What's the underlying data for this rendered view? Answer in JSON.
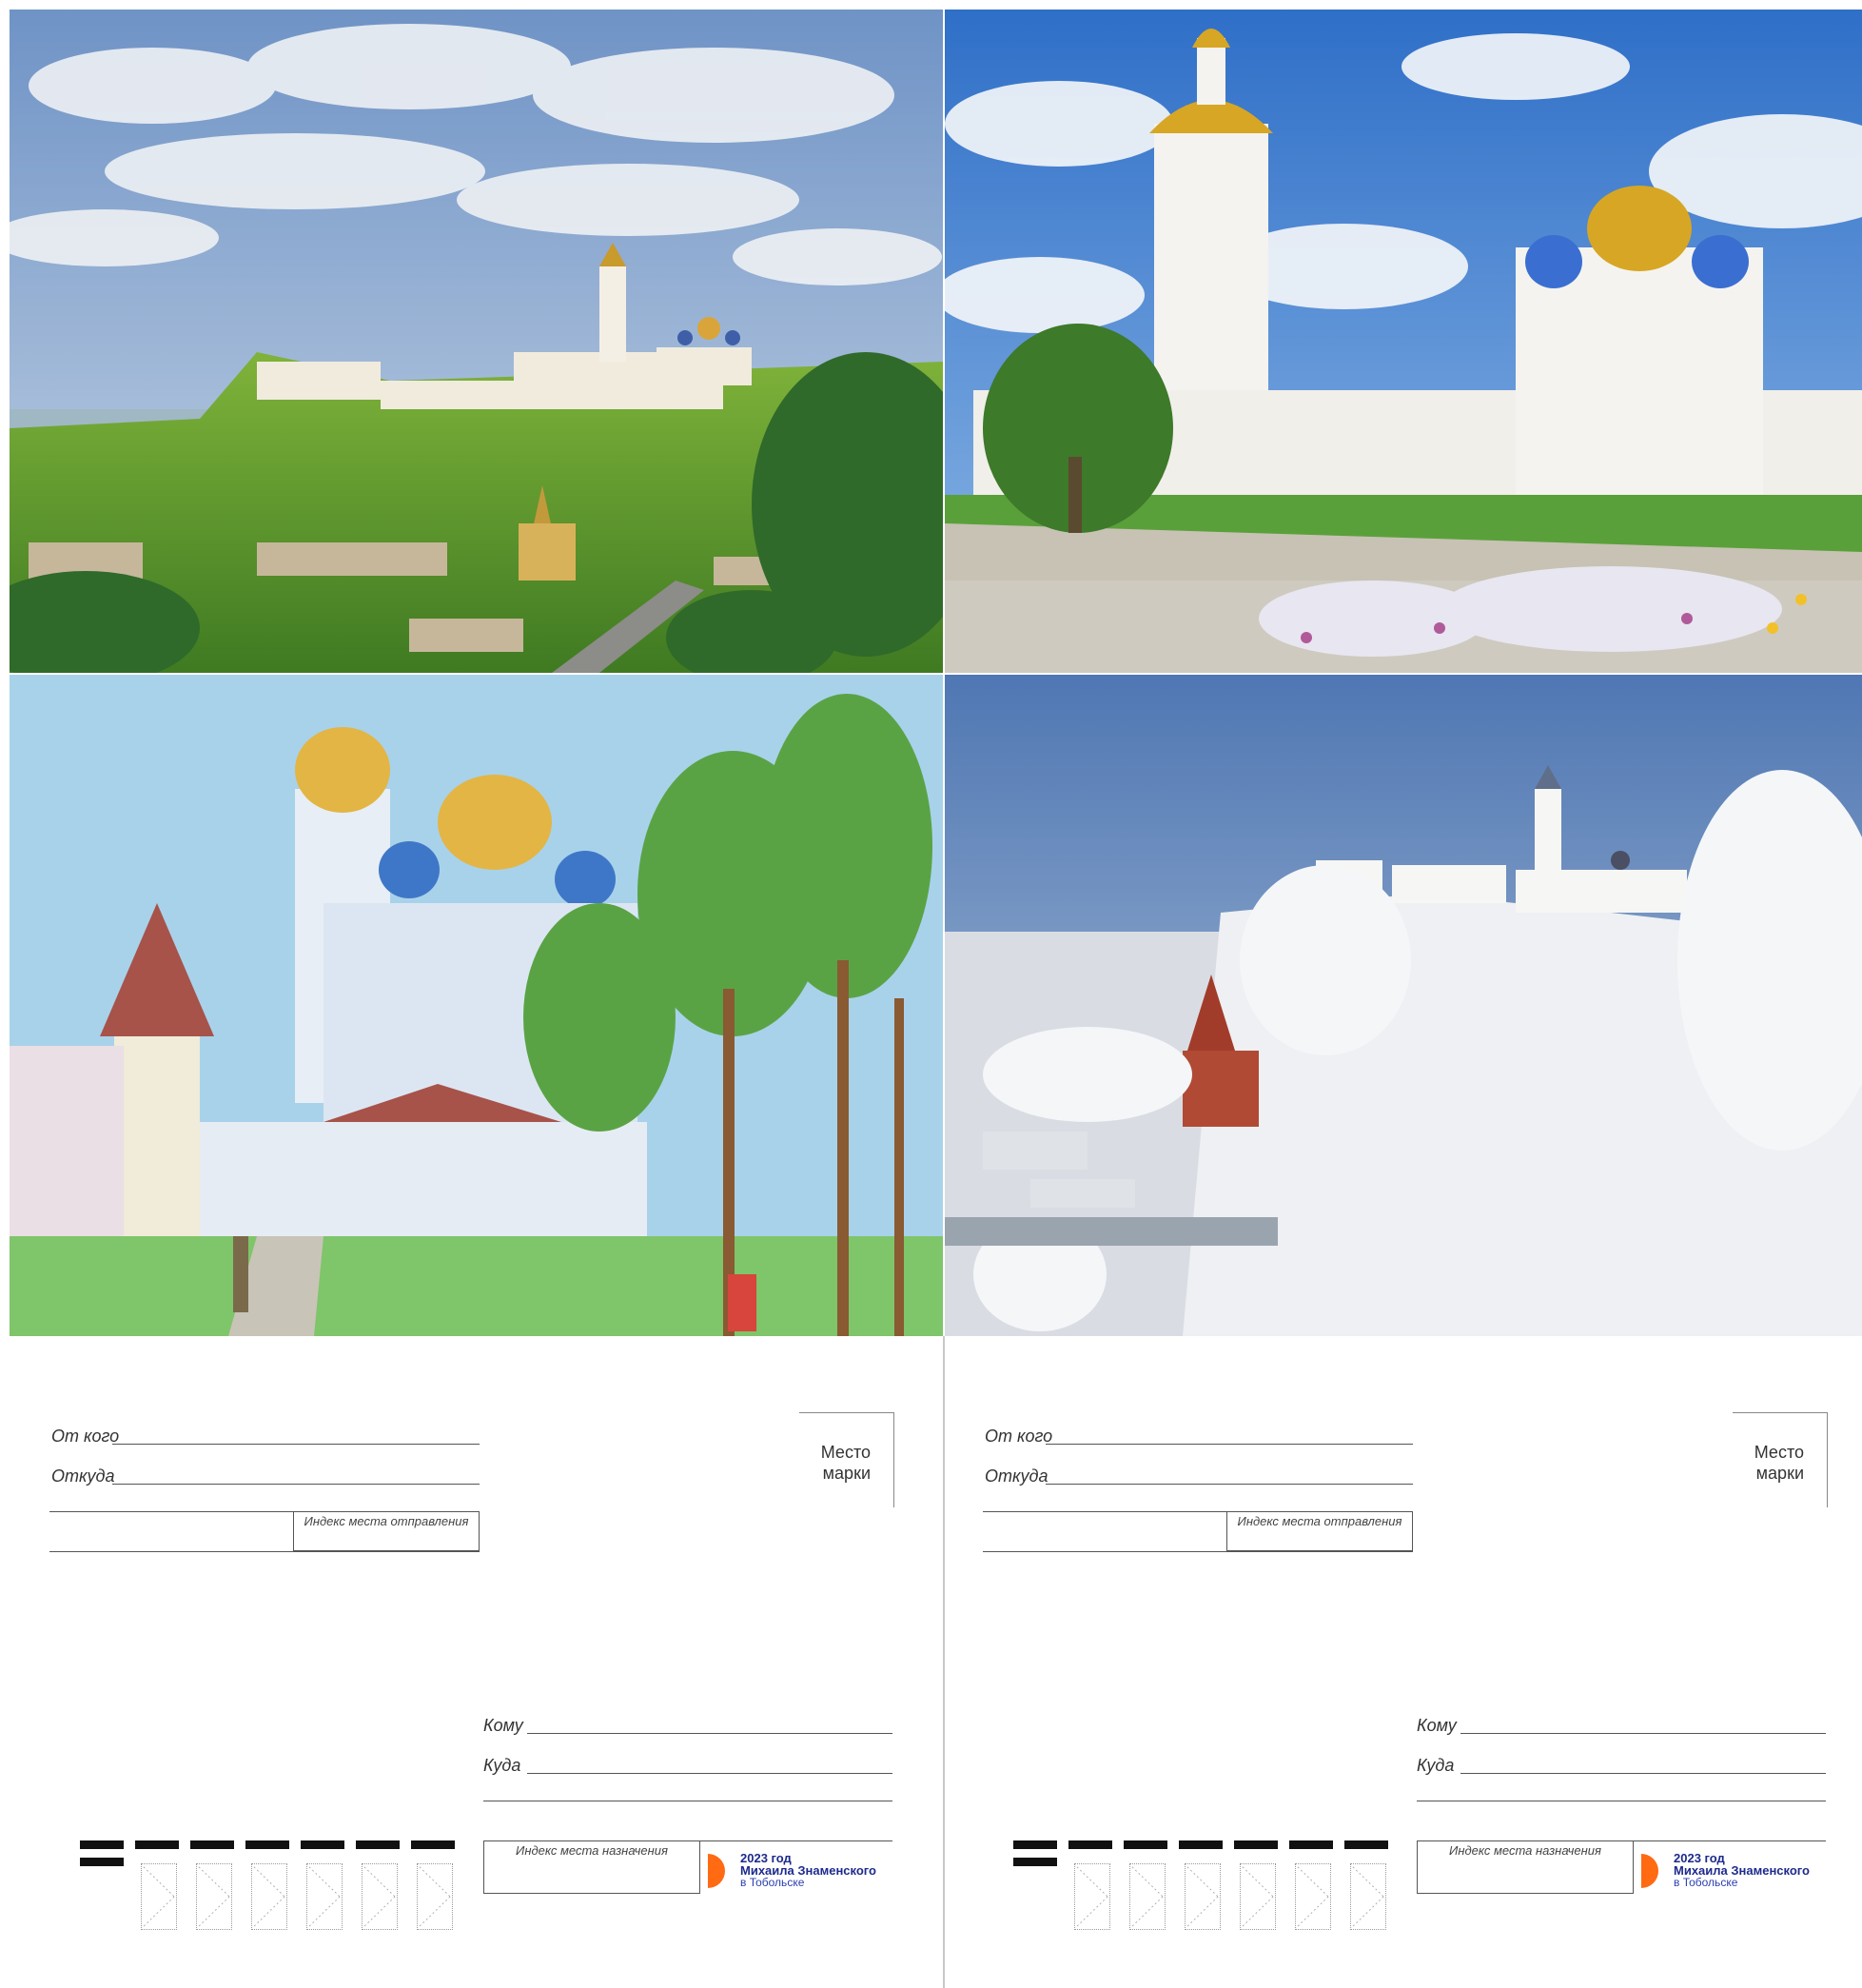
{
  "postcards": [
    {
      "from_label": "От кого",
      "origin_label": "Откуда",
      "origin_index_label": "Индекс места отправления",
      "stamp_label_line1": "Место",
      "stamp_label_line2": "марки",
      "to_label": "Кому",
      "destination_label": "Куда",
      "destination_index_label": "Индекс места назначения",
      "logo_year": "2023 год",
      "logo_name": "Михаила Знаменского",
      "logo_city": "в Тобольске"
    },
    {
      "from_label": "От кого",
      "origin_label": "Откуда",
      "origin_index_label": "Индекс места отправления",
      "stamp_label_line1": "Место",
      "stamp_label_line2": "марки",
      "to_label": "Кому",
      "destination_label": "Куда",
      "destination_index_label": "Индекс места назначения",
      "logo_year": "2023 год",
      "logo_name": "Михаила Знаменского",
      "logo_city": "в Тобольске"
    }
  ],
  "colors": {
    "logo_orange": "#ff6a13",
    "logo_blue": "#1d2a8c",
    "line": "#555555"
  },
  "images": [
    {
      "name": "tobolsk-kremlin-summer-painting"
    },
    {
      "name": "sofia-cathedral-bell-tower-painting"
    },
    {
      "name": "kremlin-cathedral-child-drawing"
    },
    {
      "name": "tobolsk-kremlin-winter-photo"
    }
  ]
}
